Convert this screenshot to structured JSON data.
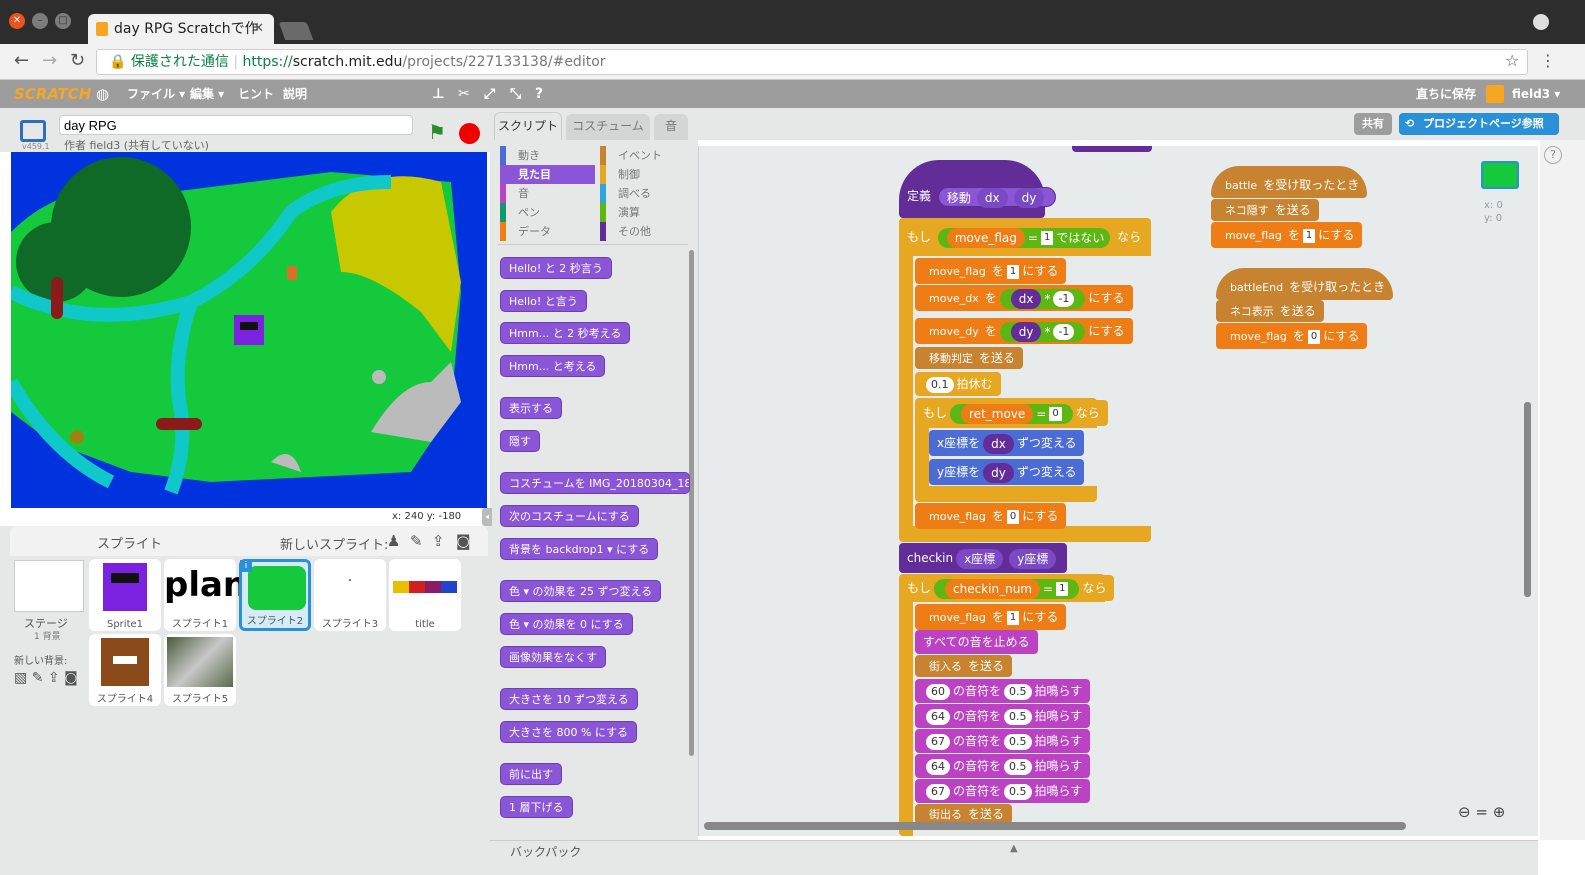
{
  "browser": {
    "tab_title": "day RPG Scratchで作",
    "secure_label": "保護された通信",
    "url_scheme": "https://",
    "url_host": "scratch.mit.edu",
    "url_path": "/projects/227133138/#editor"
  },
  "menubar": {
    "logo": "SCRATCH",
    "file": "ファイル ▾",
    "edit": "編集 ▾",
    "tips": "ヒント",
    "about": "説明",
    "save_now": "直ちに保存",
    "user": "field3 ▾",
    "share": "共有",
    "project_page": "プロジェクトページ参照"
  },
  "project": {
    "title": "day RPG",
    "author": "作者 field3 (共有していない)",
    "version": "v459.1",
    "coords": "x: 240  y: -180"
  },
  "tabs": [
    "スクリプト",
    "コスチューム",
    "音"
  ],
  "categories": [
    {
      "label": "動き",
      "color": "#4a6cd4"
    },
    {
      "label": "イベント",
      "color": "#c88330"
    },
    {
      "label": "見た目",
      "color": "#8a55d7"
    },
    {
      "label": "制御",
      "color": "#e6a822"
    },
    {
      "label": "音",
      "color": "#bb42c3"
    },
    {
      "label": "調べる",
      "color": "#2ca5e2"
    },
    {
      "label": "ペン",
      "color": "#0e9a6c"
    },
    {
      "label": "演算",
      "color": "#5cb712"
    },
    {
      "label": "データ",
      "color": "#ee7d16"
    },
    {
      "label": "その他",
      "color": "#632d99"
    }
  ],
  "palette_blocks": [
    "Hello! と 2 秒言う",
    "Hello! と言う",
    "Hmm... と 2 秒考える",
    "Hmm... と考える",
    "表示する",
    "隠す",
    "コスチュームを IMG_20180304_18",
    "次のコスチュームにする",
    "背景を backdrop1 ▾ にする",
    "色 ▾ の効果を 25 ずつ変える",
    "色 ▾ の効果を 0 にする",
    "画像効果をなくす",
    "大きさを 10 ずつ変える",
    "大きさを 800 % にする",
    "前に出す",
    "1 層下げる"
  ],
  "sprites": {
    "header": "スプライト",
    "new_sprite": "新しいスプライト:",
    "stage_label": "ステージ",
    "stage_sub": "1 背景",
    "new_backdrop": "新しい背景:",
    "items": [
      {
        "name": "Sprite1"
      },
      {
        "name": "スプライト1",
        "thumb_text": "plan"
      },
      {
        "name": "スプライト2"
      },
      {
        "name": "スプライト3",
        "thumb_text": "·"
      },
      {
        "name": "title"
      },
      {
        "name": "スプライト4"
      },
      {
        "name": "スプライト5"
      }
    ]
  },
  "script": {
    "define": "定義",
    "define_name": "移動",
    "param_dx": "dx",
    "param_dy": "dy",
    "if": "もし",
    "then": "なら",
    "not": "ではない",
    "eq": "=",
    "mul": "*",
    "move_flag": "move_flag",
    "move_dx": "move_dx",
    "move_dy": "move_dy",
    "one": "1",
    "zero": "0",
    "neg_one": "-1",
    "set_to": "を",
    "suffix_set": "にする",
    "broadcast_move": "移動判定",
    "send": "を送る",
    "wait_val": "0.1",
    "wait_label": "拍休む",
    "ret_move": "ret_move",
    "change_x": "x座標を",
    "change_y": "y座標を",
    "change_by": "ずつ変える",
    "checkin": "checkin",
    "xcoord": "x座標",
    "ycoord": "y座標",
    "checkin_num": "checkin_num",
    "stop_sounds": "すべての音を止める",
    "enter_town": "街入る",
    "exit_town": "街出る",
    "note_label": "の音符を",
    "beat_val": "0.5",
    "beat_label": "拍鳴らす",
    "notes": [
      "60",
      "64",
      "67",
      "64",
      "67"
    ],
    "when_receive": "を受け取ったとき",
    "battle": "battle",
    "battle_end": "battleEnd",
    "hide_cat": "ネコ隠す",
    "show_cat": "ネコ表示",
    "mini_x": "x: 0",
    "mini_y": "y: 0"
  },
  "backpack": "バックパック"
}
